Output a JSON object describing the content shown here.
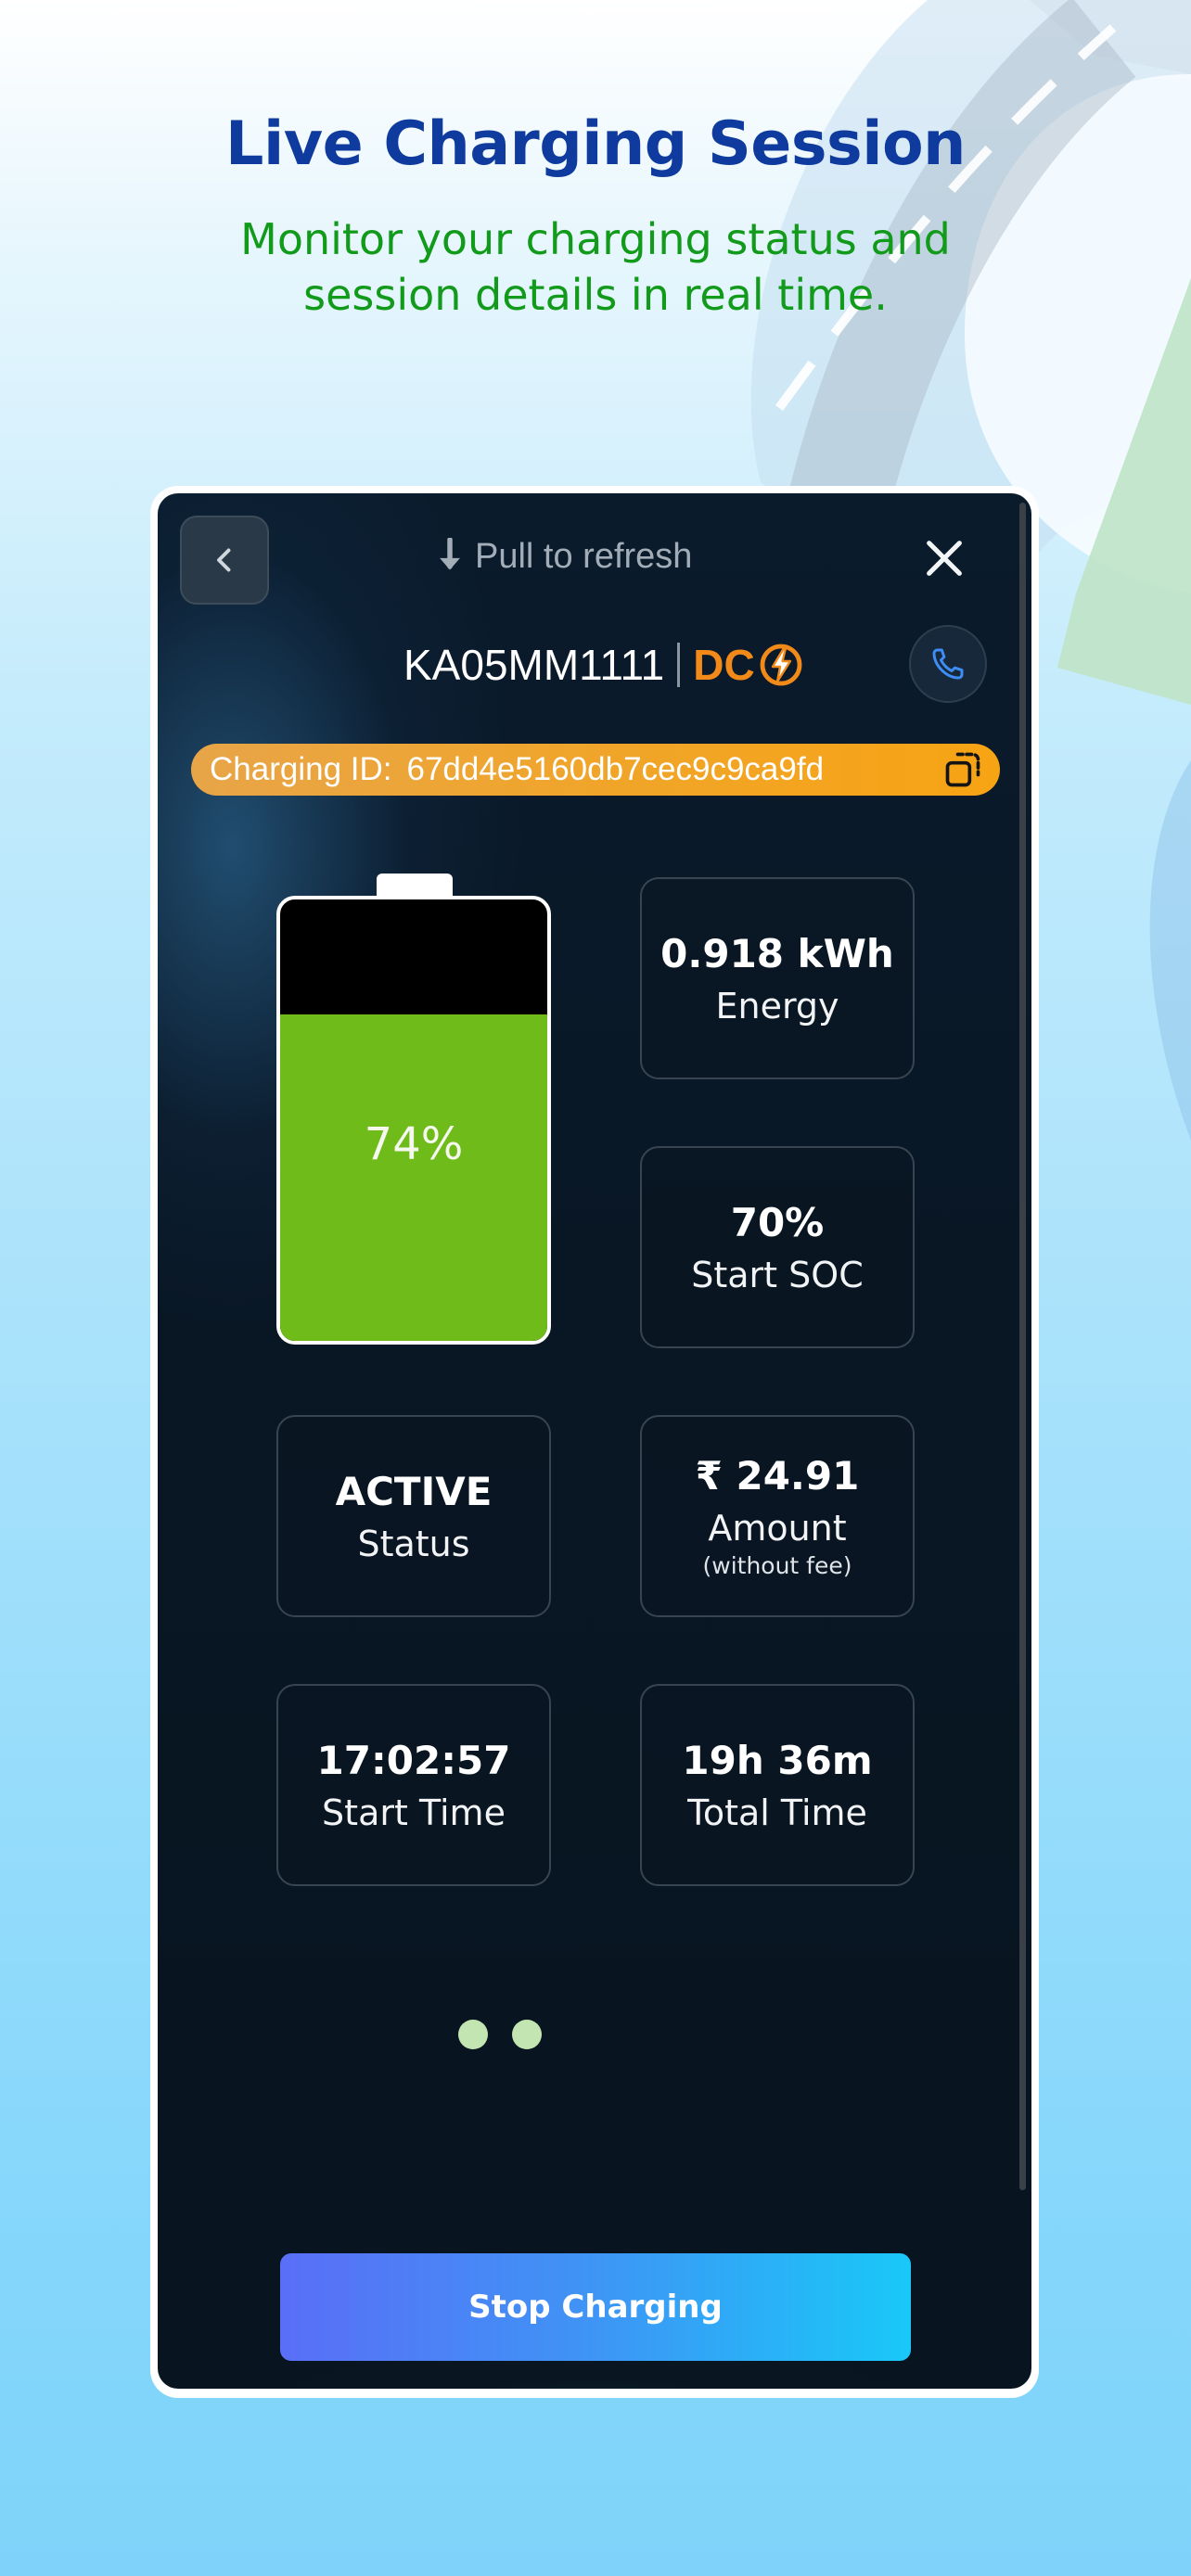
{
  "promo": {
    "title": "Live Charging Session",
    "subtitle": "Monitor your charging status and session details in real time."
  },
  "header": {
    "back_icon": "chevron-left-icon",
    "pull_icon": "arrow-down-icon",
    "pull_text": "Pull to refresh",
    "close_icon": "close-icon"
  },
  "vehicle": {
    "plate": "KA05MM1111",
    "charger_type": "DC",
    "charger_icon": "bolt-icon",
    "call_icon": "phone-icon"
  },
  "charging_id": {
    "label": "Charging ID:",
    "value": "67dd4e5160db7cec9c9ca9fd",
    "copy_icon": "copy-icon"
  },
  "battery": {
    "percent_label": "74%",
    "level": 0.74
  },
  "stats": {
    "energy": {
      "value": "0.918 kWh",
      "label": "Energy"
    },
    "start_soc": {
      "value": "70%",
      "label": "Start SOC"
    },
    "status": {
      "value": "ACTIVE",
      "label": "Status"
    },
    "amount": {
      "value": "₹ 24.91",
      "label": "Amount",
      "note": "(without fee)"
    },
    "start_time": {
      "value": "17:02:57",
      "label": "Start Time"
    },
    "total_time": {
      "value": "19h 36m",
      "label": "Total Time"
    }
  },
  "pager": {
    "pages": 2
  },
  "actions": {
    "stop_label": "Stop Charging"
  },
  "colors": {
    "title": "#0f3a9e",
    "subtitle": "#129a1b",
    "battery_fill": "#6fbb19",
    "charging_id_bg": "#f7a414",
    "dc_accent": "#f28a1a"
  }
}
